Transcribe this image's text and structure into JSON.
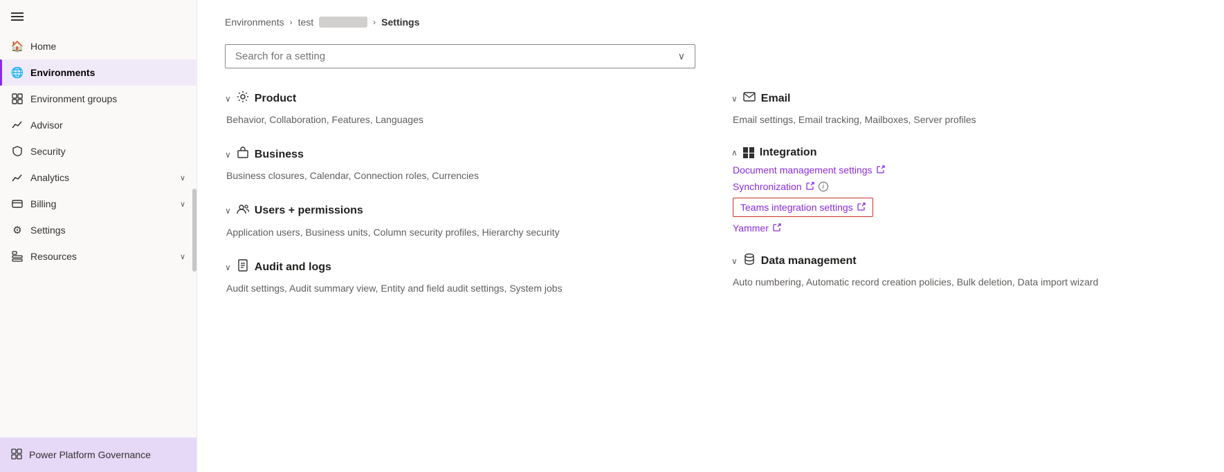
{
  "sidebar": {
    "hamburger_label": "menu",
    "items": [
      {
        "id": "home",
        "label": "Home",
        "icon": "🏠",
        "active": false,
        "chevron": false
      },
      {
        "id": "environments",
        "label": "Environments",
        "icon": "🌐",
        "active": true,
        "chevron": false
      },
      {
        "id": "environment-groups",
        "label": "Environment groups",
        "icon": "📋",
        "active": false,
        "chevron": false
      },
      {
        "id": "advisor",
        "label": "Advisor",
        "icon": "📈",
        "active": false,
        "chevron": false
      },
      {
        "id": "security",
        "label": "Security",
        "icon": "🛡",
        "active": false,
        "chevron": false
      },
      {
        "id": "analytics",
        "label": "Analytics",
        "icon": "📊",
        "active": false,
        "chevron": true
      },
      {
        "id": "billing",
        "label": "Billing",
        "icon": "💳",
        "active": false,
        "chevron": true
      },
      {
        "id": "settings",
        "label": "Settings",
        "icon": "⚙",
        "active": false,
        "chevron": false
      },
      {
        "id": "resources",
        "label": "Resources",
        "icon": "🗂",
        "active": false,
        "chevron": true
      }
    ],
    "partial_item_label": "Power Platform Governance"
  },
  "breadcrumb": {
    "environments": "Environments",
    "sep1": "›",
    "test": "test",
    "redacted": "██████",
    "sep2": "›",
    "current": "Settings"
  },
  "search": {
    "placeholder": "Search for a setting"
  },
  "sections_left": [
    {
      "id": "product",
      "collapsed": false,
      "icon_type": "gear",
      "title": "Product",
      "links": "Behavior, Collaboration, Features, Languages"
    },
    {
      "id": "business",
      "collapsed": false,
      "icon_type": "business",
      "title": "Business",
      "links": "Business closures, Calendar, Connection roles, Currencies"
    },
    {
      "id": "users-permissions",
      "collapsed": false,
      "icon_type": "users",
      "title": "Users + permissions",
      "links": "Application users, Business units, Column security profiles, Hierarchy security"
    },
    {
      "id": "audit-logs",
      "collapsed": false,
      "icon_type": "audit",
      "title": "Audit and logs",
      "links": "Audit settings, Audit summary view, Entity and field audit settings, System jobs"
    }
  ],
  "sections_right": [
    {
      "id": "email",
      "collapsed": false,
      "icon_type": "email",
      "title": "Email",
      "links": "Email settings, Email tracking, Mailboxes, Server profiles",
      "is_integration": false
    },
    {
      "id": "integration",
      "collapsed": true,
      "icon_type": "windows",
      "title": "Integration",
      "is_integration": true,
      "integration_links": [
        {
          "label": "Document management settings",
          "ext": true,
          "info": false,
          "highlighted": false
        },
        {
          "label": "Synchronization",
          "ext": true,
          "info": true,
          "highlighted": false
        },
        {
          "label": "Teams integration settings",
          "ext": true,
          "info": false,
          "highlighted": true
        },
        {
          "label": "Yammer",
          "ext": true,
          "info": false,
          "highlighted": false
        }
      ]
    },
    {
      "id": "data-management",
      "collapsed": false,
      "icon_type": "data",
      "title": "Data management",
      "links": "Auto numbering, Automatic record creation policies, Bulk deletion, Data import wizard",
      "is_integration": false
    }
  ]
}
